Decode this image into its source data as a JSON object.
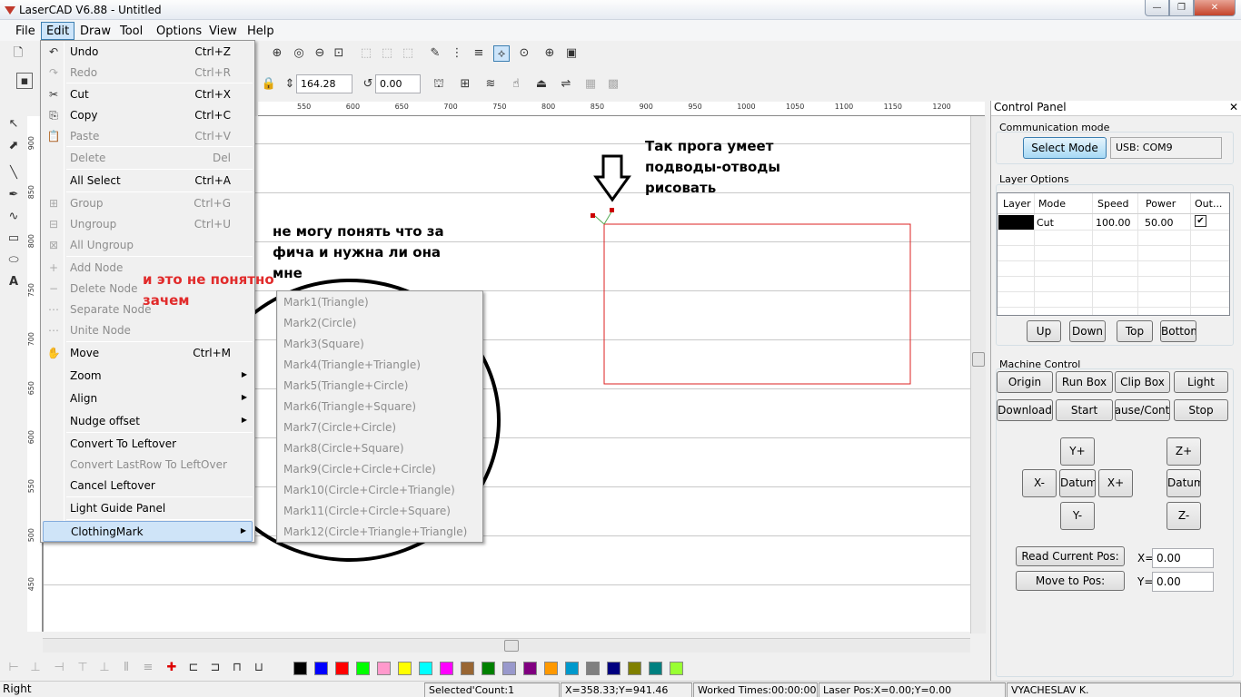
{
  "window": {
    "title": "LaserCAD V6.88 - Untitled",
    "btn_min": "—",
    "btn_max": "❐",
    "btn_close": "✕"
  },
  "menubar": [
    "File",
    "Edit",
    "Draw",
    "Tool",
    "Options",
    "View",
    "Help"
  ],
  "toolbar": {
    "width_value": "164.28",
    "angle_value": "0.00"
  },
  "ruler": {
    "h_ticks": [
      "550",
      "600",
      "650",
      "700",
      "750",
      "800",
      "850",
      "900",
      "950",
      "1000",
      "1050",
      "1100",
      "1150",
      "1200"
    ],
    "v_ticks": [
      "900",
      "850",
      "800",
      "750",
      "700",
      "650",
      "600",
      "550",
      "500",
      "450"
    ]
  },
  "edit_menu": {
    "items": [
      {
        "label": "Undo",
        "shortcut": "Ctrl+Z",
        "icon": "↶",
        "disabled": false
      },
      {
        "label": "Redo",
        "shortcut": "Ctrl+R",
        "icon": "↷",
        "disabled": true
      },
      {
        "label": "Cut",
        "shortcut": "Ctrl+X",
        "icon": "✂",
        "disabled": false
      },
      {
        "label": "Copy",
        "shortcut": "Ctrl+C",
        "icon": "⎘",
        "disabled": false
      },
      {
        "label": "Paste",
        "shortcut": "Ctrl+V",
        "icon": "📋",
        "disabled": true
      },
      {
        "label": "Delete",
        "shortcut": "Del",
        "icon": "",
        "disabled": true
      },
      {
        "label": "All Select",
        "shortcut": "Ctrl+A",
        "icon": "",
        "disabled": false
      },
      {
        "label": "Group",
        "shortcut": "Ctrl+G",
        "icon": "⊞",
        "disabled": true
      },
      {
        "label": "Ungroup",
        "shortcut": "Ctrl+U",
        "icon": "⊟",
        "disabled": true
      },
      {
        "label": "All Ungroup",
        "shortcut": "",
        "icon": "⊠",
        "disabled": true
      },
      {
        "label": "Add Node",
        "shortcut": "",
        "icon": "+",
        "disabled": true
      },
      {
        "label": "Delete Node",
        "shortcut": "",
        "icon": "−",
        "disabled": true
      },
      {
        "label": "Separate Node",
        "shortcut": "",
        "icon": "⋯",
        "disabled": true
      },
      {
        "label": "Unite Node",
        "shortcut": "",
        "icon": "⋯",
        "disabled": true
      },
      {
        "label": "Move",
        "shortcut": "Ctrl+M",
        "icon": "✋",
        "disabled": false
      },
      {
        "label": "Zoom",
        "shortcut": "",
        "icon": "",
        "disabled": false,
        "submenu": true
      },
      {
        "label": "Align",
        "shortcut": "",
        "icon": "",
        "disabled": false,
        "submenu": true
      },
      {
        "label": "Nudge offset",
        "shortcut": "",
        "icon": "",
        "disabled": false,
        "submenu": true
      },
      {
        "label": "Convert To Leftover",
        "shortcut": "",
        "icon": "",
        "disabled": false
      },
      {
        "label": "Convert LastRow To LeftOver",
        "shortcut": "",
        "icon": "",
        "disabled": true
      },
      {
        "label": "Cancel Leftover",
        "shortcut": "",
        "icon": "",
        "disabled": false
      },
      {
        "label": "Light Guide Panel",
        "shortcut": "",
        "icon": "",
        "disabled": false
      },
      {
        "label": "ClothingMark",
        "shortcut": "",
        "icon": "",
        "disabled": false,
        "submenu": true,
        "highlighted": true
      }
    ]
  },
  "clothing_submenu": [
    "Mark1(Triangle)",
    "Mark2(Circle)",
    "Mark3(Square)",
    "Mark4(Triangle+Triangle)",
    "Mark5(Triangle+Circle)",
    "Mark6(Triangle+Square)",
    "Mark7(Circle+Circle)",
    "Mark8(Circle+Square)",
    "Mark9(Circle+Circle+Circle)",
    "Mark10(Circle+Circle+Triangle)",
    "Mark11(Circle+Circle+Square)",
    "Mark12(Circle+Triangle+Triangle)"
  ],
  "annotations": {
    "top_right": [
      "Так прога умеет",
      "подводы-отводы",
      "рисовать"
    ],
    "middle": [
      "не могу понять что за",
      "фича и нужна ли она",
      "мне"
    ],
    "red": [
      "и это не понятно",
      "зачем"
    ]
  },
  "control_panel": {
    "title": "Control Panel",
    "comm_label": "Communication mode",
    "select_mode": "Select Mode",
    "usb": "USB: COM9",
    "layer_label": "Layer Options",
    "layer_headers": [
      "Layer",
      "Mode",
      "Speed",
      "Power",
      "Out..."
    ],
    "layer_row": {
      "color": "#000000",
      "mode": "Cut",
      "speed": "100.00",
      "power": "50.00",
      "out": "✔"
    },
    "layer_buttons": [
      "Up",
      "Down",
      "Top",
      "Bottom"
    ],
    "machine_label": "Machine Control",
    "machine_buttons": [
      "Origin",
      "Run Box",
      "Clip Box",
      "Light",
      "Download",
      "Start",
      "Pause/Continue",
      "Stop"
    ],
    "jog": {
      "yplus": "Y+",
      "xminus": "X-",
      "datum": "Datum",
      "xplus": "X+",
      "yminus": "Y-",
      "zplus": "Z+",
      "zdatum": "Datum",
      "zminus": "Z-"
    },
    "read_pos": "Read Current Pos:",
    "move_pos": "Move to Pos:",
    "x_label": "X=",
    "y_label": "Y=",
    "x_value": "0.00",
    "y_value": "0.00"
  },
  "palette": [
    "#000000",
    "#0000ff",
    "#ff0000",
    "#00ff00",
    "#ff99cc",
    "#ffff00",
    "#00ffff",
    "#ff00ff",
    "#996633",
    "#008000",
    "#9999cc",
    "#800080",
    "#ff9900",
    "#0099cc",
    "#808080",
    "#000080",
    "#808000",
    "#008080",
    "#99ff33"
  ],
  "status": {
    "mode": "Right",
    "selected": "Selected'Count:1",
    "coords": "X=358.33;Y=941.46",
    "worked": "Worked Times:00:00:00",
    "laser_pos": "Laser Pos:X=0.00;Y=0.00",
    "user": "VYACHESLAV K."
  }
}
